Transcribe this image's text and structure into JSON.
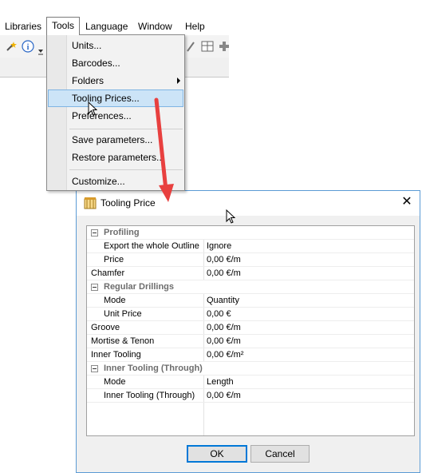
{
  "menubar": {
    "items": [
      {
        "label": "Libraries"
      },
      {
        "label": "Tools"
      },
      {
        "label": "Language"
      },
      {
        "label": "Window"
      },
      {
        "label": "Help"
      }
    ]
  },
  "tools_menu": {
    "items": [
      {
        "label": "Units..."
      },
      {
        "label": "Barcodes..."
      },
      {
        "label": "Folders"
      },
      {
        "label": "Tooling Prices..."
      },
      {
        "label": "Preferences..."
      },
      {
        "label": "Save parameters..."
      },
      {
        "label": "Restore parameters..."
      },
      {
        "label": "Customize..."
      }
    ]
  },
  "dialog": {
    "title": "Tooling Price",
    "rows": [
      {
        "name": "Profiling",
        "value": ""
      },
      {
        "name": "Export the whole Outline",
        "value": "Ignore"
      },
      {
        "name": "Price",
        "value": "0,00 €/m"
      },
      {
        "name": "Chamfer",
        "value": "0,00 €/m"
      },
      {
        "name": "Regular Drillings",
        "value": ""
      },
      {
        "name": "Mode",
        "value": "Quantity"
      },
      {
        "name": "Unit Price",
        "value": "0,00 €"
      },
      {
        "name": "Groove",
        "value": "0,00 €/m"
      },
      {
        "name": "Mortise & Tenon",
        "value": "0,00 €/m"
      },
      {
        "name": "Inner Tooling",
        "value": "0,00 €/m²"
      },
      {
        "name": "Inner Tooling (Through)",
        "value": ""
      },
      {
        "name": "Mode",
        "value": "Length"
      },
      {
        "name": "Inner Tooling (Through)",
        "value": "0,00 €/m"
      }
    ],
    "ok_label": "OK",
    "cancel_label": "Cancel"
  },
  "icons": {
    "wand": "wand-icon",
    "info": "info-icon",
    "grid": "grid-layout-icon",
    "plus": "plus-icon",
    "close": "close-icon",
    "dialog": "tooling-price-icon"
  },
  "colors": {
    "highlight": "#cce4f7",
    "accent_arrow": "#e8403f",
    "dialog_border": "#5b9bd5"
  }
}
